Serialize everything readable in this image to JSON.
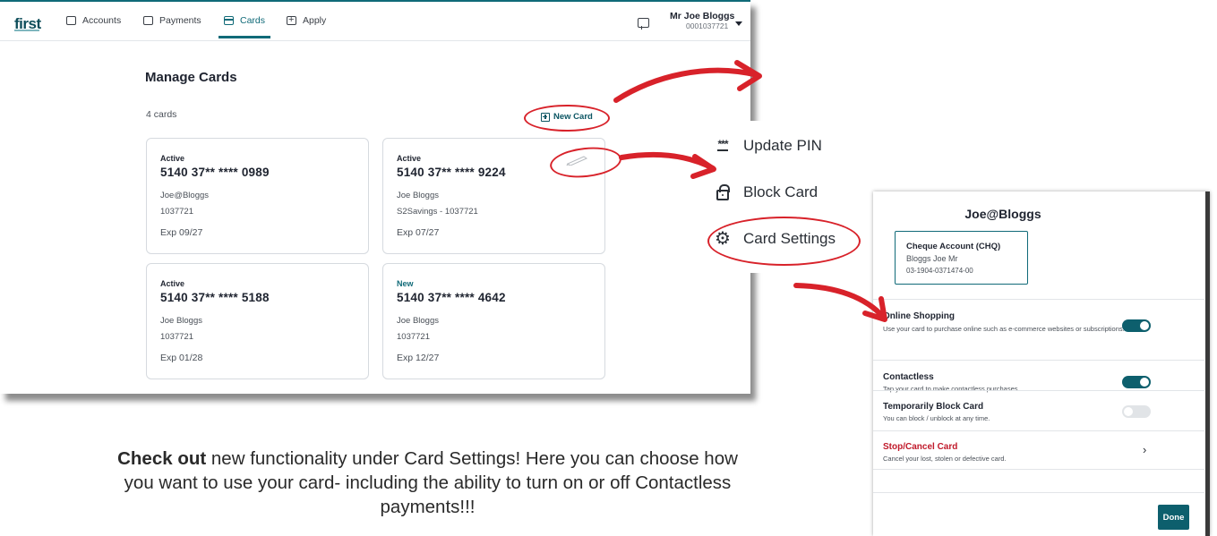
{
  "app": {
    "logo": "first",
    "nav": [
      {
        "label": "Accounts"
      },
      {
        "label": "Payments"
      },
      {
        "label": "Cards"
      },
      {
        "label": "Apply"
      }
    ],
    "user_name": "Mr Joe Bloggs",
    "user_number": "0001037721"
  },
  "main": {
    "title": "Manage Cards",
    "card_count": "4 cards",
    "new_card_label": "New Card",
    "cards": [
      {
        "status": "Active",
        "number": "5140 37** **** 0989",
        "holder": "Joe@Bloggs",
        "account": "1037721",
        "expiry": "Exp 09/27"
      },
      {
        "status": "Active",
        "number": "5140 37** **** 9224",
        "holder": "Joe Bloggs",
        "account": "S2Savings - 1037721",
        "expiry": "Exp 07/27"
      },
      {
        "status": "Active",
        "number": "5140 37** **** 5188",
        "holder": "Joe Bloggs",
        "account": "1037721",
        "expiry": "Exp 01/28"
      },
      {
        "status": "New",
        "number": "5140 37** **** 4642",
        "holder": "Joe Bloggs",
        "account": "1037721",
        "expiry": "Exp 12/27"
      }
    ]
  },
  "menu": {
    "pin_glyph": "***",
    "items": [
      {
        "label": "Update PIN",
        "icon": "pin-icon"
      },
      {
        "label": "Block Card",
        "icon": "lock-icon"
      },
      {
        "label": "Card Settings",
        "icon": "gear-icon"
      }
    ]
  },
  "settings": {
    "title": "Joe@Bloggs",
    "account_name": "Cheque Account (CHQ)",
    "account_holder": "Bloggs Joe Mr",
    "account_number": "03-1904-0371474-00",
    "rows": [
      {
        "title": "Online Shopping",
        "desc": "Use your card to purchase online such as e-commerce websites or subscriptions.",
        "toggle": "on"
      },
      {
        "title": "Contactless",
        "desc": "Tap your card to make contactless purchases.",
        "toggle": "on"
      },
      {
        "title": "Temporarily Block Card",
        "desc": "You can block / unblock at any time.",
        "toggle": "off"
      },
      {
        "title": "Stop/Cancel Card",
        "desc": "Cancel your lost, stolen or defective card.",
        "chevron": "›"
      }
    ],
    "done_label": "Done"
  },
  "caption": {
    "bold": "Check out",
    "line1_rest": " new functionality under Card Settings! Here you can choose how",
    "line2": "you want to use your card- including the ability to turn on or off Contactless",
    "line3": "payments!!!"
  },
  "colors": {
    "brand": "#106a78",
    "highlight": "#d8222a",
    "danger": "#c0192a"
  }
}
